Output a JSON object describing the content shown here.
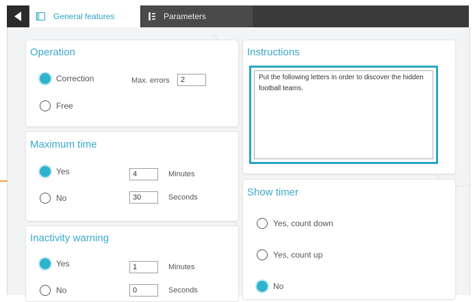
{
  "tabs": {
    "general_label": "General features",
    "parameters_label": "Parameters"
  },
  "operation": {
    "title": "Operation",
    "options": [
      "Correction",
      "Free"
    ],
    "selected": "Correction",
    "max_errors_label": "Max. errors",
    "max_errors_value": "2"
  },
  "instructions": {
    "title": "Instructions",
    "text": "Put the following letters in order to discover the hidden football teams."
  },
  "maximum_time": {
    "title": "Maximum time",
    "options": [
      "Yes",
      "No"
    ],
    "selected": "Yes",
    "minutes_value": "4",
    "minutes_label": "Minutes",
    "seconds_value": "30",
    "seconds_label": "Seconds"
  },
  "show_timer": {
    "title": "Show timer",
    "options": [
      "Yes, count down",
      "Yes, count up",
      "No"
    ],
    "selected": "No"
  },
  "inactivity_warning": {
    "title": "Inactivity warning",
    "options": [
      "Yes",
      "No"
    ],
    "selected": "Yes",
    "minutes_value": "1",
    "minutes_label": "Minutes",
    "seconds_value": "0",
    "seconds_label": "Seconds"
  },
  "colors": {
    "accent": "#2eb3cf",
    "tab_bar": "#3a3a3a",
    "highlight_box": "#2aa5c0"
  }
}
